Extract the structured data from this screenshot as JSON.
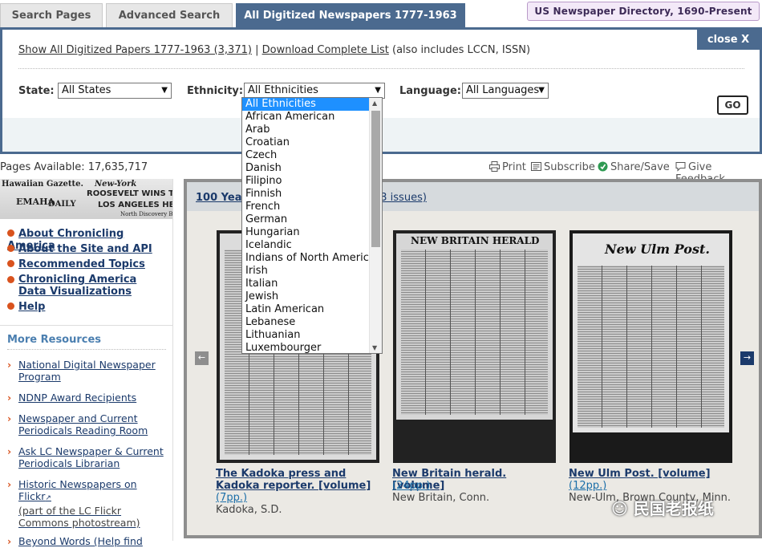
{
  "tabs": [
    {
      "label": "Search Pages"
    },
    {
      "label": "Advanced Search"
    },
    {
      "label": "All Digitized Newspapers 1777-1963"
    }
  ],
  "directory_button": "US Newspaper Directory, 1690-Present",
  "panel": {
    "close_label": "close X",
    "show_all_link": "Show All Digitized Papers 1777-1963 (3,371)",
    "separator": "|",
    "download_link": "Download Complete List",
    "download_note": "(also includes LCCN, ISSN)",
    "state_label": "State:",
    "state_value": "All States",
    "ethnicity_label": "Ethnicity:",
    "ethnicity_value": "All Ethnicities",
    "language_label": "Language:",
    "language_value": "All Languages",
    "go_label": "GO"
  },
  "ethnicity_options": [
    "All Ethnicities",
    "African American",
    "Arab",
    "Croatian",
    "Czech",
    "Danish",
    "Filipino",
    "Finnish",
    "French",
    "German",
    "Hungarian",
    "Icelandic",
    "Indians of North America",
    "Irish",
    "Italian",
    "Jewish",
    "Latin American",
    "Lebanese",
    "Lithuanian",
    "Luxembourger"
  ],
  "pages_available": "Pages Available: 17,635,717",
  "tools": {
    "print": "Print",
    "subscribe": "Subscribe",
    "share": "Share/Save",
    "feedback": "Give Feedback"
  },
  "masthead": {
    "line1a": "Hawaiian Gazette.",
    "line1b": "New-York",
    "line2": "ROOSEVELT WINS TRI",
    "line3a": "EMAHA",
    "line3b": "DAILY",
    "line4": "LOS ANGELES HE",
    "line5": "North Discovery Bel"
  },
  "nav": [
    "About Chronicling America",
    "About the Site and API",
    "Recommended Topics",
    "Chronicling America Data Visualizations",
    "Help"
  ],
  "more_resources_title": "More Resources",
  "resources": [
    {
      "label": "National Digital Newspaper Program"
    },
    {
      "label": "NDNP Award Recipients"
    },
    {
      "label": "Newspaper and Current Periodicals Reading Room"
    },
    {
      "label": "Ask LC Newspaper & Current Periodicals Librarian"
    },
    {
      "label": "Historic Newspapers on Flickr",
      "sub": "(part of the LC Flickr Commons photostream)"
    },
    {
      "label": "Beyond Words (Help find"
    }
  ],
  "carousel": {
    "title": "100 Years",
    "issues": "03 issues)",
    "items": [
      {
        "title": "The Kadoka press and Kadoka reporter. [volume]",
        "pages": "(7pp.)",
        "place": "Kadoka, S.D.",
        "masthead": ""
      },
      {
        "title": "New Britain herald. [volume]",
        "pages": "(24pp.)",
        "place": "New Britain, Conn.",
        "masthead": "NEW BRITAIN HERALD"
      },
      {
        "title": "New Ulm Post. [volume]",
        "pages": "(12pp.)",
        "place": "New-Ulm, Brown County, Minn.",
        "masthead": "New Ulm Post."
      }
    ]
  },
  "watermark": "民国老报纸"
}
